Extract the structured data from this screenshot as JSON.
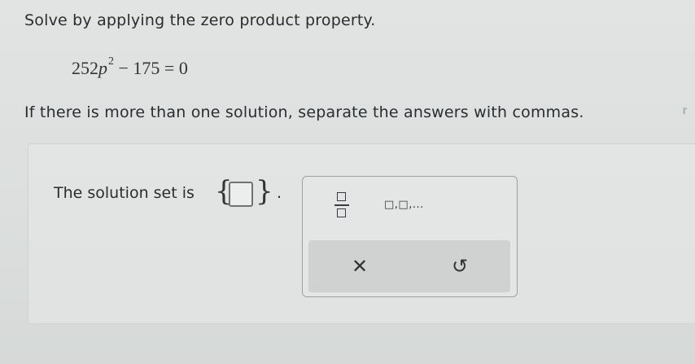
{
  "question": {
    "prompt": "Solve by applying the zero product property.",
    "equation": {
      "coefficient": "252",
      "variable": "p",
      "exponent": "2",
      "rest": " − 175 = 0"
    },
    "instruction": "If there is more than one solution, separate the answers with commas."
  },
  "answer": {
    "label": "The solution set is",
    "brace_open": "{",
    "brace_close": "}",
    "period": ".",
    "value": ""
  },
  "keypad": {
    "list_label": "□,□,...",
    "clear_icon": "✕",
    "undo_icon": "↺"
  },
  "icons": {
    "fraction": "fraction-icon",
    "clear": "x-icon",
    "undo": "undo-icon"
  }
}
